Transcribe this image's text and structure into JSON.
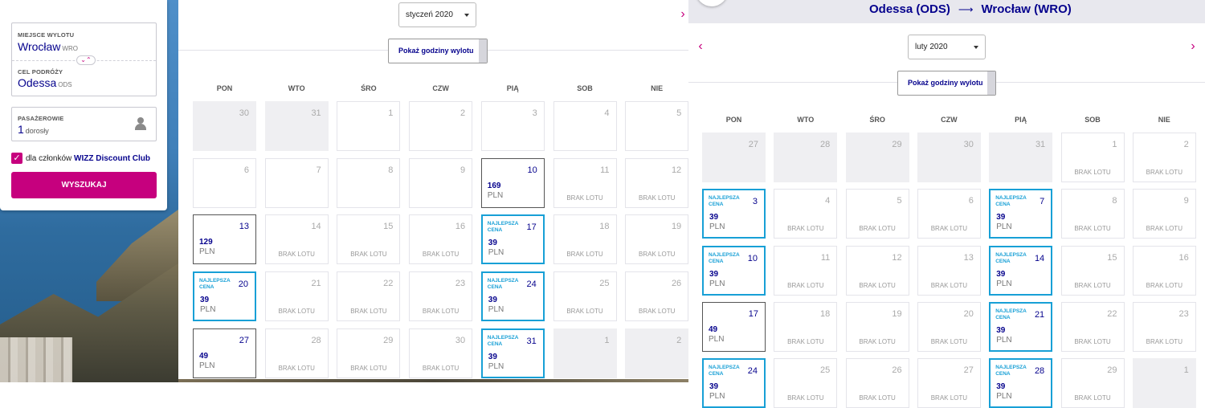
{
  "search": {
    "from_label": "MIEJSCE WYLOTU",
    "from_city": "Wrocław",
    "from_code": "WRO",
    "to_label": "CEL PODRÓŻY",
    "to_city": "Odessa",
    "to_code": "ODS",
    "pax_label": "PASAŻEROWIE",
    "pax_count": "1",
    "pax_type": "dorosły",
    "club_prefix": "dla członków ",
    "club_name": "WIZZ Discount Club",
    "club_checked": true,
    "search_button": "WYSZUKAJ"
  },
  "route_header": {
    "from": "Odessa (ODS)",
    "arrow": "⟶",
    "to": "Wrocław (WRO)"
  },
  "common": {
    "hours_button": "Pokaż godziny wylotu",
    "no_flight": "BRAK LOTU",
    "best_price": "NAJLEPSZA CENA",
    "currency": "PLN",
    "weekdays": [
      "PON",
      "WTO",
      "ŚRO",
      "CZW",
      "PIĄ",
      "SOB",
      "NIE"
    ],
    "prev_icon": "chevron-left-icon",
    "next_icon": "chevron-right-icon"
  },
  "colors": {
    "brand": "#c6007e",
    "navy": "#06038d",
    "best": "#18a0d6"
  },
  "calendars": [
    {
      "month": "styczeń 2020",
      "weeks": [
        [
          {
            "d": "30",
            "s": "past"
          },
          {
            "d": "31",
            "s": "past"
          },
          {
            "d": "1",
            "s": "empty"
          },
          {
            "d": "2",
            "s": "empty"
          },
          {
            "d": "3",
            "s": "empty"
          },
          {
            "d": "4",
            "s": "empty"
          },
          {
            "d": "5",
            "s": "empty"
          }
        ],
        [
          {
            "d": "6",
            "s": "empty"
          },
          {
            "d": "7",
            "s": "empty"
          },
          {
            "d": "8",
            "s": "empty"
          },
          {
            "d": "9",
            "s": "empty"
          },
          {
            "d": "10",
            "s": "price",
            "p": "169"
          },
          {
            "d": "11",
            "s": "none"
          },
          {
            "d": "12",
            "s": "none"
          }
        ],
        [
          {
            "d": "13",
            "s": "price",
            "p": "129"
          },
          {
            "d": "14",
            "s": "none"
          },
          {
            "d": "15",
            "s": "none"
          },
          {
            "d": "16",
            "s": "none"
          },
          {
            "d": "17",
            "s": "best",
            "p": "39"
          },
          {
            "d": "18",
            "s": "none"
          },
          {
            "d": "19",
            "s": "none"
          }
        ],
        [
          {
            "d": "20",
            "s": "best",
            "p": "39"
          },
          {
            "d": "21",
            "s": "none"
          },
          {
            "d": "22",
            "s": "none"
          },
          {
            "d": "23",
            "s": "none"
          },
          {
            "d": "24",
            "s": "best",
            "p": "39"
          },
          {
            "d": "25",
            "s": "none"
          },
          {
            "d": "26",
            "s": "none"
          }
        ],
        [
          {
            "d": "27",
            "s": "price",
            "p": "49"
          },
          {
            "d": "28",
            "s": "none"
          },
          {
            "d": "29",
            "s": "none"
          },
          {
            "d": "30",
            "s": "none"
          },
          {
            "d": "31",
            "s": "best",
            "p": "39"
          },
          {
            "d": "1",
            "s": "past"
          },
          {
            "d": "2",
            "s": "past"
          }
        ]
      ]
    },
    {
      "month": "luty 2020",
      "weeks": [
        [
          {
            "d": "27",
            "s": "past"
          },
          {
            "d": "28",
            "s": "past"
          },
          {
            "d": "29",
            "s": "past"
          },
          {
            "d": "30",
            "s": "past"
          },
          {
            "d": "31",
            "s": "past"
          },
          {
            "d": "1",
            "s": "none"
          },
          {
            "d": "2",
            "s": "none"
          }
        ],
        [
          {
            "d": "3",
            "s": "best",
            "p": "39"
          },
          {
            "d": "4",
            "s": "none"
          },
          {
            "d": "5",
            "s": "none"
          },
          {
            "d": "6",
            "s": "none"
          },
          {
            "d": "7",
            "s": "best",
            "p": "39"
          },
          {
            "d": "8",
            "s": "none"
          },
          {
            "d": "9",
            "s": "none"
          }
        ],
        [
          {
            "d": "10",
            "s": "best",
            "p": "39"
          },
          {
            "d": "11",
            "s": "none"
          },
          {
            "d": "12",
            "s": "none"
          },
          {
            "d": "13",
            "s": "none"
          },
          {
            "d": "14",
            "s": "best",
            "p": "39"
          },
          {
            "d": "15",
            "s": "none"
          },
          {
            "d": "16",
            "s": "none"
          }
        ],
        [
          {
            "d": "17",
            "s": "price",
            "p": "49"
          },
          {
            "d": "18",
            "s": "none"
          },
          {
            "d": "19",
            "s": "none"
          },
          {
            "d": "20",
            "s": "none"
          },
          {
            "d": "21",
            "s": "best",
            "p": "39"
          },
          {
            "d": "22",
            "s": "none"
          },
          {
            "d": "23",
            "s": "none"
          }
        ],
        [
          {
            "d": "24",
            "s": "best",
            "p": "39"
          },
          {
            "d": "25",
            "s": "none"
          },
          {
            "d": "26",
            "s": "none"
          },
          {
            "d": "27",
            "s": "none"
          },
          {
            "d": "28",
            "s": "best",
            "p": "39"
          },
          {
            "d": "29",
            "s": "none"
          },
          {
            "d": "1",
            "s": "past"
          }
        ]
      ]
    }
  ]
}
